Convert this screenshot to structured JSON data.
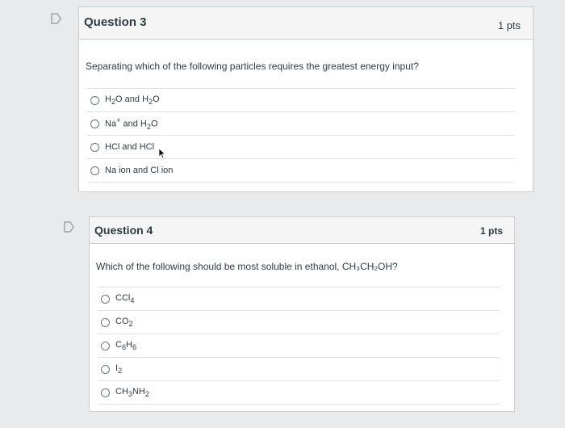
{
  "questions": [
    {
      "title": "Question 3",
      "points": "1 pts",
      "text": "Separating which of the following particles requires the greatest energy input?",
      "answers": [
        {
          "html": "H<sub>2</sub>O and H<sub>2</sub>O"
        },
        {
          "html": "Na<sup>+</sup> and H<sub>2</sub>O"
        },
        {
          "html": "HCl and HCl"
        },
        {
          "html": "Na ion and Cl ion"
        }
      ]
    },
    {
      "title": "Question 4",
      "points": "1 pts",
      "text": "Which of the following should be most soluble in ethanol, CH₃CH₂OH?",
      "answers": [
        {
          "html": "CCl<sub>4</sub>"
        },
        {
          "html": "CO<sub>2</sub>"
        },
        {
          "html": "C<sub>6</sub>H<sub>6</sub>"
        },
        {
          "html": "I<sub>2</sub>"
        },
        {
          "html": "CH<sub>3</sub>NH<sub>2</sub>"
        }
      ]
    }
  ]
}
